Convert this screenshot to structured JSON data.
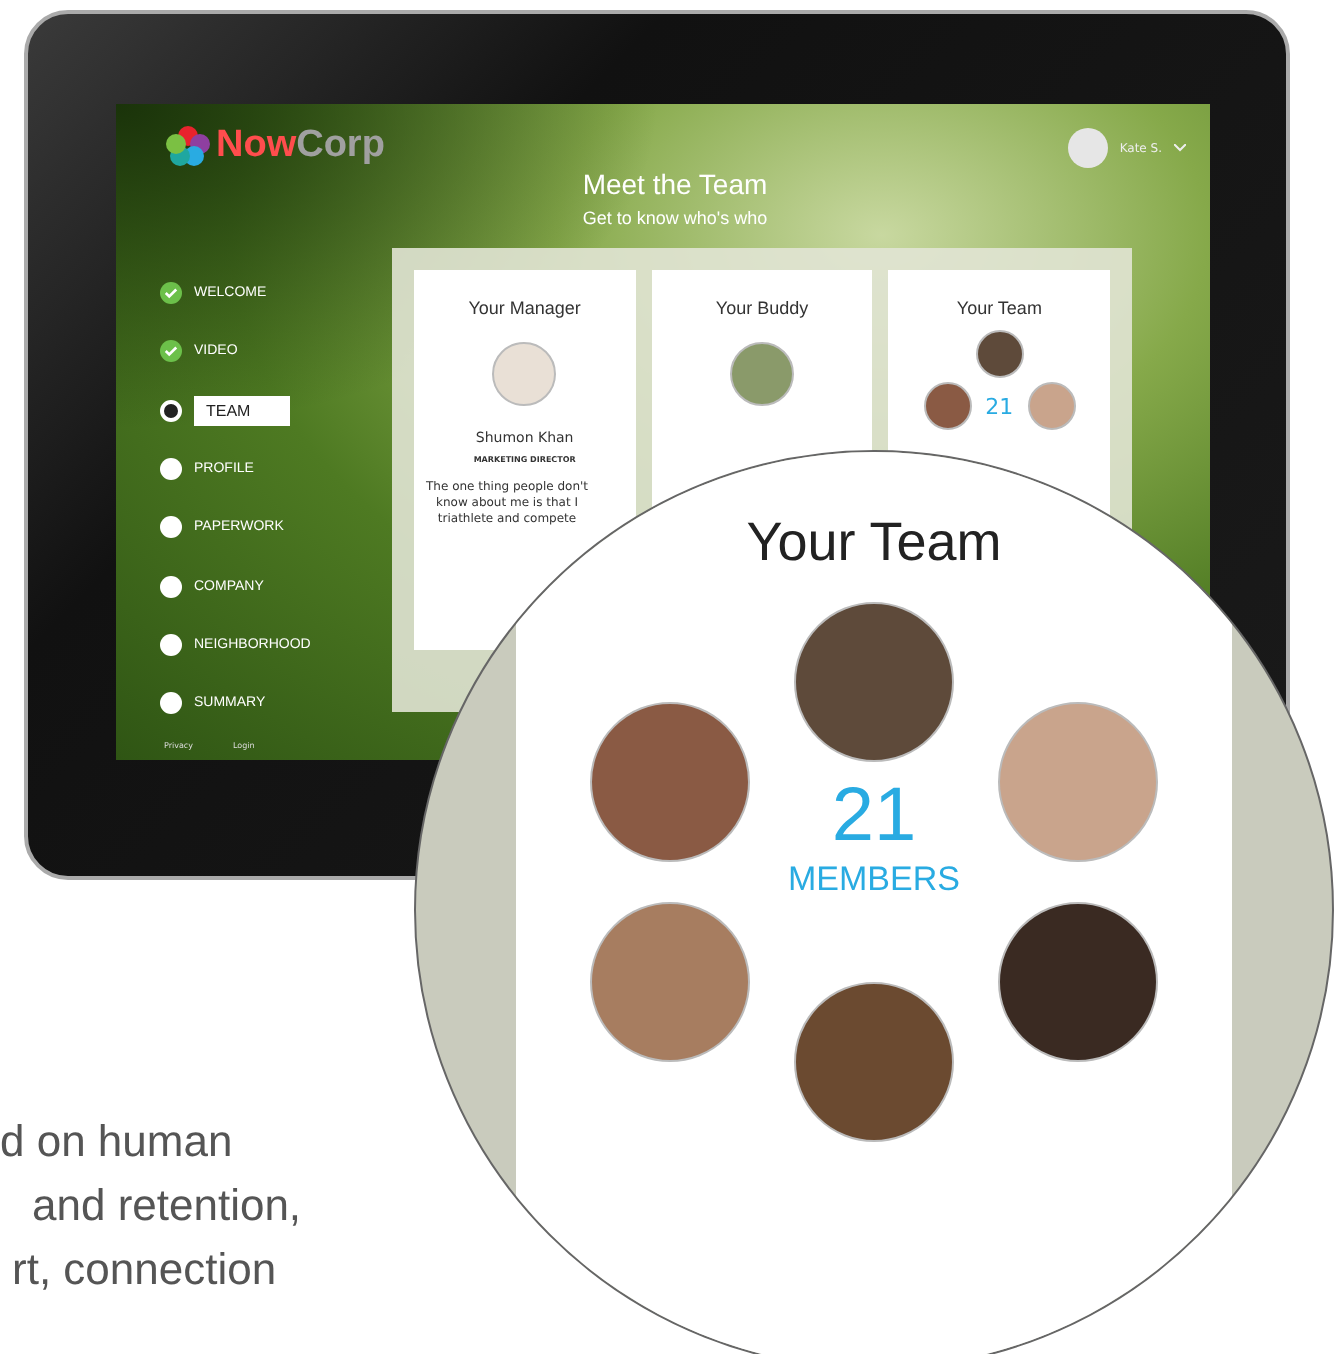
{
  "brand": {
    "first": "Now",
    "second": "Corp"
  },
  "header": {
    "title": "Meet the Team",
    "subtitle": "Get to know who's who"
  },
  "user": {
    "name": "Kate S."
  },
  "steps": [
    {
      "label": "WELCOME",
      "done": true,
      "selected": false
    },
    {
      "label": "VIDEO",
      "done": true,
      "selected": false
    },
    {
      "label": "TEAM",
      "done": false,
      "selected": true
    },
    {
      "label": "PROFILE",
      "done": false,
      "selected": false
    },
    {
      "label": "PAPERWORK",
      "done": false,
      "selected": false
    },
    {
      "label": "COMPANY",
      "done": false,
      "selected": false
    },
    {
      "label": "NEIGHBORHOOD",
      "done": false,
      "selected": false
    },
    {
      "label": "SUMMARY",
      "done": false,
      "selected": false
    }
  ],
  "footer_links": [
    "Privacy",
    "Login"
  ],
  "manager_card": {
    "title": "Your Manager",
    "name": "Shumon Khan",
    "role": "MARKETING DIRECTOR",
    "bio_lines": [
      "The one thing people don't",
      "know about me is that I",
      "triathlete and compete"
    ]
  },
  "buddy_card": {
    "title": "Your Buddy"
  },
  "team_card": {
    "title": "Your Team",
    "count": "21"
  },
  "magnified_team": {
    "title": "Your Team",
    "count": "21",
    "unit": "MEMBERS"
  },
  "caption_lines": [
    "d on human",
    "and retention,",
    "rt, connection"
  ]
}
